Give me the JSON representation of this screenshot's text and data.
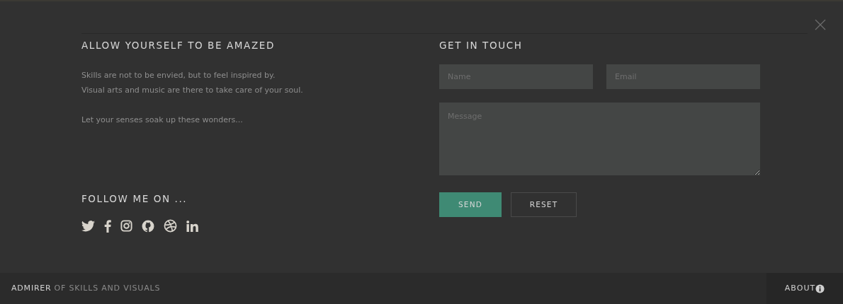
{
  "intro": {
    "heading": "ALLOW YOURSELF TO BE AMAZED",
    "lines": [
      "Skills are not to be envied, but to feel inspired by.",
      "Visual arts and music are there to take care of your soul."
    ],
    "closing": "Let your senses soak up these wonders..."
  },
  "follow": {
    "heading": "FOLLOW ME ON ..."
  },
  "contact": {
    "heading": "GET IN TOUCH",
    "fields": [
      {
        "placeholder": "Name"
      },
      {
        "placeholder": "Email"
      }
    ],
    "message": {
      "placeholder": "Message"
    },
    "buttons": [
      {
        "label": "SEND",
        "kind": "primary"
      },
      {
        "label": "RESET",
        "kind": "outline"
      }
    ]
  },
  "footer": {
    "brand": "ADMIRER",
    "tagline": "OF SKILLS AND VISUALS",
    "about": "ABOUT"
  }
}
